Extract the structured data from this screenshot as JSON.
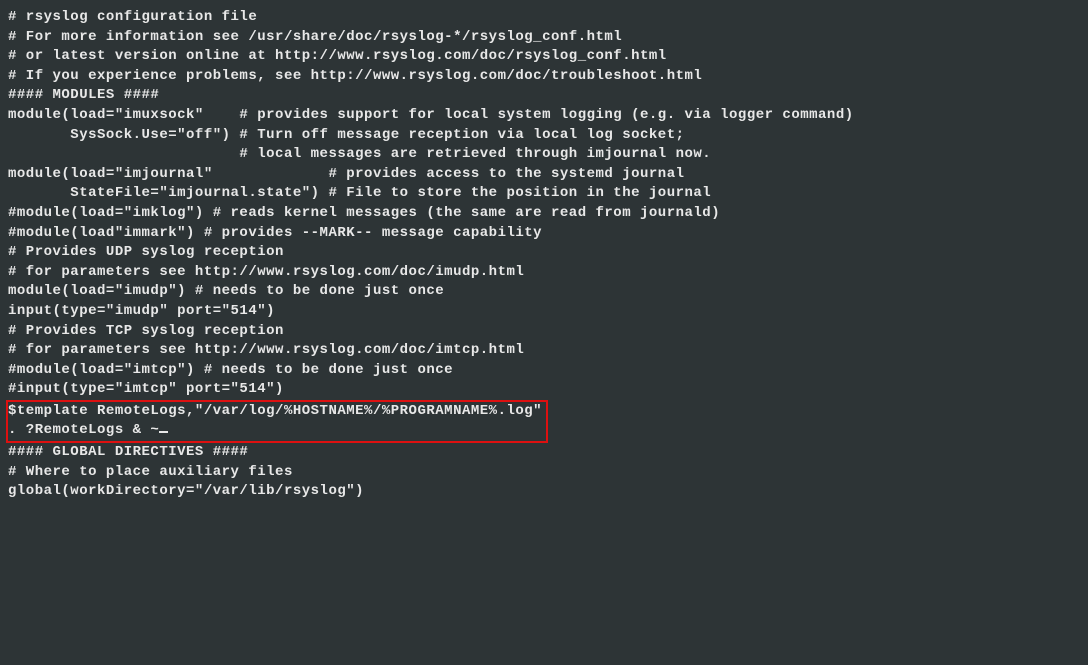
{
  "lines": {
    "l0": "# rsyslog configuration file",
    "l1": "",
    "l2": "# For more information see /usr/share/doc/rsyslog-*/rsyslog_conf.html",
    "l3": "# or latest version online at http://www.rsyslog.com/doc/rsyslog_conf.html",
    "l4": "# If you experience problems, see http://www.rsyslog.com/doc/troubleshoot.html",
    "l5": "",
    "l6": "#### MODULES ####",
    "l7": "",
    "l8": "module(load=\"imuxsock\"    # provides support for local system logging (e.g. via logger command)",
    "l9": "       SysSock.Use=\"off\") # Turn off message reception via local log socket;",
    "l10": "                          # local messages are retrieved through imjournal now.",
    "l11": "module(load=\"imjournal\"             # provides access to the systemd journal",
    "l12": "       StateFile=\"imjournal.state\") # File to store the position in the journal",
    "l13": "#module(load=\"imklog\") # reads kernel messages (the same are read from journald)",
    "l14": "#module(load\"immark\") # provides --MARK-- message capability",
    "l15": "",
    "l16": "# Provides UDP syslog reception",
    "l17": "# for parameters see http://www.rsyslog.com/doc/imudp.html",
    "l18": "module(load=\"imudp\") # needs to be done just once",
    "l19": "input(type=\"imudp\" port=\"514\")",
    "l20": "",
    "l21": "# Provides TCP syslog reception",
    "l22": "# for parameters see http://www.rsyslog.com/doc/imtcp.html",
    "l23": "#module(load=\"imtcp\") # needs to be done just once",
    "l24": "#input(type=\"imtcp\" port=\"514\")",
    "l25": "",
    "h1": "$template RemoteLogs,\"/var/log/%HOSTNAME%/%PROGRAMNAME%.log\"",
    "h2": ". ?RemoteLogs & ~",
    "l28": "",
    "l29": "#### GLOBAL DIRECTIVES ####",
    "l30": "",
    "l31": "# Where to place auxiliary files",
    "l32": "global(workDirectory=\"/var/lib/rsyslog\")"
  }
}
